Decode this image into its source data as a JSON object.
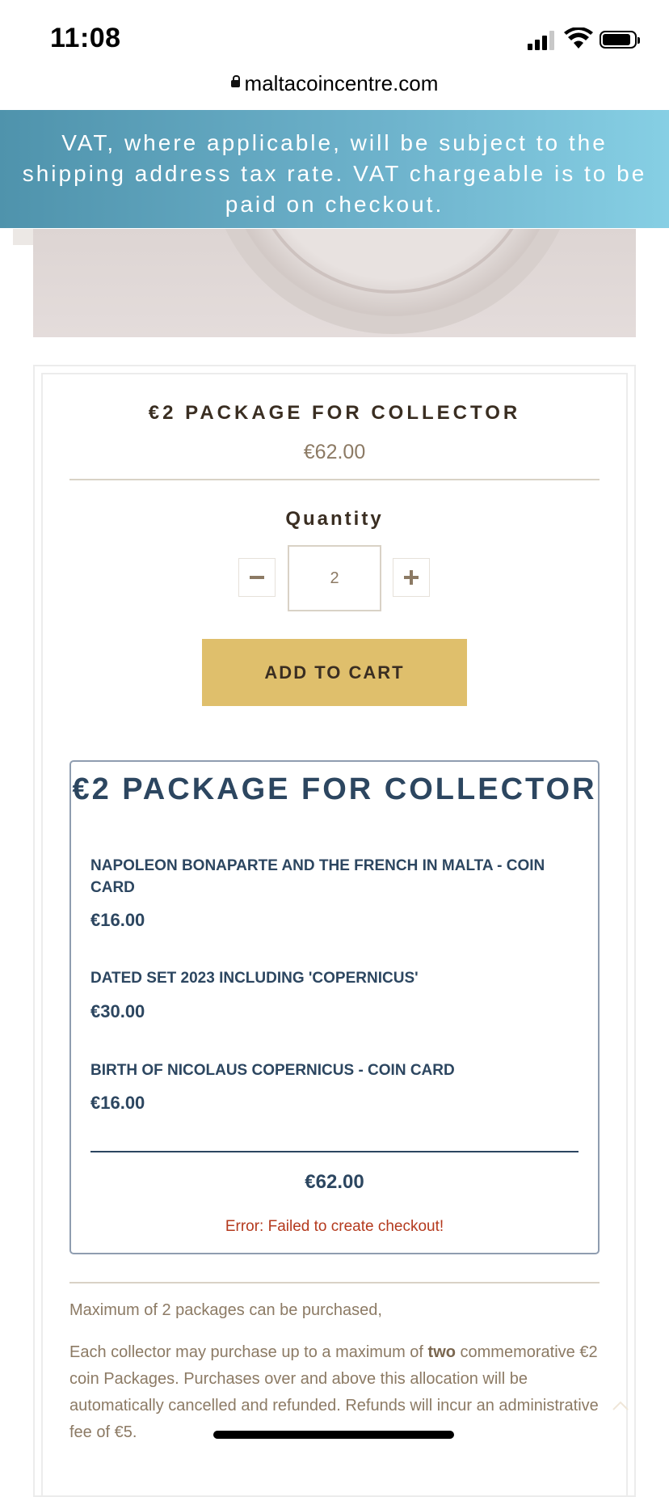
{
  "status_bar": {
    "time": "11:08"
  },
  "browser": {
    "url": "maltacoincentre.com"
  },
  "banner": {
    "text": "VAT, where applicable, will be subject to the shipping address tax rate. VAT chargeable is to be paid on checkout."
  },
  "product": {
    "title": "€2 PACKAGE FOR COLLECTOR",
    "price": "€62.00",
    "quantity_label": "Quantity",
    "quantity_value": "2",
    "add_to_cart_label": "ADD TO CART"
  },
  "package": {
    "title": "€2 PACKAGE FOR COLLECTOR",
    "items": [
      {
        "name": "NAPOLEON BONAPARTE AND THE FRENCH IN MALTA - COIN CARD",
        "price": "€16.00"
      },
      {
        "name": "DATED SET 2023 INCLUDING 'COPERNICUS'",
        "price": "€30.00"
      },
      {
        "name": "BIRTH OF NICOLAUS COPERNICUS - COIN CARD",
        "price": "€16.00"
      }
    ],
    "total": "€62.00",
    "error": "Error: Failed to create checkout!"
  },
  "notes": {
    "max_packages": "Maximum of 2 packages can be purchased,",
    "desc_before": "Each collector may purchase up to a maximum of ",
    "desc_bold": "two",
    "desc_after": " commemorative €2 coin Packages. Purchases over and above this allocation will be automatically cancelled and refunded. Refunds will incur an administrative fee of €5."
  },
  "colors": {
    "accent_gold": "#dfbf6c",
    "package_navy": "#2c4660",
    "error_red": "#b43a1e",
    "banner_blue": "#5fa6bf"
  }
}
